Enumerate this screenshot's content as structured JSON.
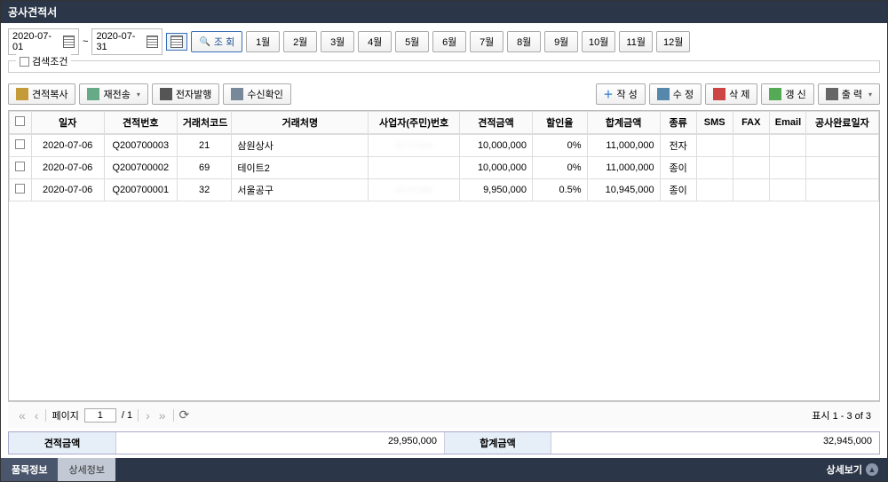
{
  "title": "공사견적서",
  "date_from": "2020-07-01",
  "date_to": "2020-07-31",
  "search_label": "조 회",
  "months": [
    "1월",
    "2월",
    "3월",
    "4월",
    "5월",
    "6월",
    "7월",
    "8월",
    "9월",
    "10월",
    "11월",
    "12월"
  ],
  "search_cond": "검색조건",
  "buttons": {
    "copy": "견적복사",
    "resend": "재전송",
    "edoc": "전자발행",
    "rcvchk": "수신확인",
    "create": "작 성",
    "edit": "수 정",
    "delete": "삭 제",
    "refresh": "갱 신",
    "print": "출 력"
  },
  "columns": [
    "",
    "일자",
    "견적번호",
    "거래처코드",
    "거래처명",
    "사업자(주민)번호",
    "견적금액",
    "할인율",
    "합계금액",
    "종류",
    "SMS",
    "FAX",
    "Email",
    "공사완료일자"
  ],
  "rows": [
    {
      "date": "2020-07-06",
      "no": "Q200700003",
      "code": "21",
      "name": "삼원상사",
      "biz": "··· ·· ·····",
      "est": "10,000,000",
      "disc": "0%",
      "total": "11,000,000",
      "type": "전자",
      "sms": "",
      "fax": "",
      "email": "",
      "done": ""
    },
    {
      "date": "2020-07-06",
      "no": "Q200700002",
      "code": "69",
      "name": "테이트2",
      "biz": "",
      "est": "10,000,000",
      "disc": "0%",
      "total": "11,000,000",
      "type": "종이",
      "sms": "",
      "fax": "",
      "email": "",
      "done": ""
    },
    {
      "date": "2020-07-06",
      "no": "Q200700001",
      "code": "32",
      "name": "서울공구",
      "biz": "··· ·· ·····",
      "est": "9,950,000",
      "disc": "0.5%",
      "total": "10,945,000",
      "type": "종이",
      "sms": "",
      "fax": "",
      "email": "",
      "done": ""
    }
  ],
  "pager": {
    "label": "페이지",
    "page": "1",
    "total": "/ 1",
    "display": "표시 1 - 3 of 3"
  },
  "summary": {
    "est_label": "견적금액",
    "est_value": "29,950,000",
    "tot_label": "합계금액",
    "tot_value": "32,945,000"
  },
  "footer": {
    "tab1": "품목정보",
    "tab2": "상세정보",
    "detail": "상세보기"
  }
}
